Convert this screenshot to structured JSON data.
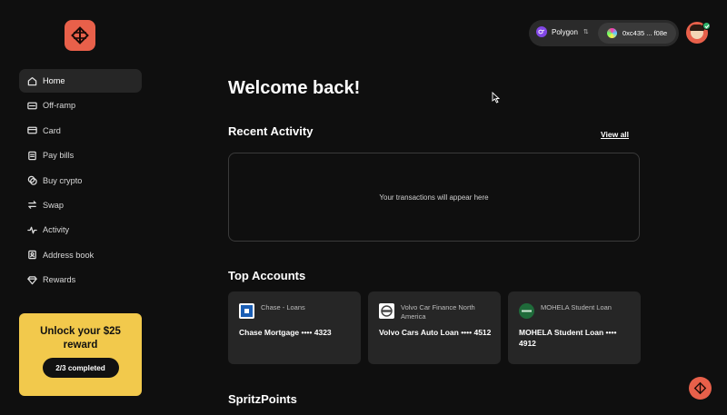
{
  "brand": {
    "accent": "#e8604a",
    "promo_bg": "#f2c94c"
  },
  "sidebar": {
    "items": [
      {
        "label": "Home",
        "icon": "home-icon",
        "active": true
      },
      {
        "label": "Off-ramp",
        "icon": "off-ramp-icon"
      },
      {
        "label": "Card",
        "icon": "card-icon"
      },
      {
        "label": "Pay bills",
        "icon": "pay-bills-icon"
      },
      {
        "label": "Buy crypto",
        "icon": "buy-crypto-icon"
      },
      {
        "label": "Swap",
        "icon": "swap-icon"
      },
      {
        "label": "Activity",
        "icon": "activity-icon"
      },
      {
        "label": "Address book",
        "icon": "address-book-icon"
      },
      {
        "label": "Rewards",
        "icon": "rewards-icon"
      }
    ],
    "promo": {
      "title": "Unlock your $25 reward",
      "button": "2/3 completed"
    }
  },
  "header": {
    "network": "Polygon",
    "address": "0xc435 ... f08e"
  },
  "main": {
    "welcome": "Welcome back!",
    "recent_activity": {
      "title": "Recent Activity",
      "view_all": "View all",
      "empty_text": "Your transactions will appear here"
    },
    "top_accounts": {
      "title": "Top Accounts",
      "cards": [
        {
          "bank": "Chase - Loans",
          "account": "Chase Mortgage •••• 4323",
          "logo": "chase-logo"
        },
        {
          "bank": "Volvo Car Finance North America",
          "account": "Volvo Cars Auto Loan •••• 4512",
          "logo": "volvo-logo"
        },
        {
          "bank": "MOHELA Student Loan",
          "account": "MOHELA Student Loan •••• 4912",
          "logo": "mohela-logo"
        }
      ]
    },
    "spritz_points": {
      "title": "SpritzPoints"
    }
  }
}
